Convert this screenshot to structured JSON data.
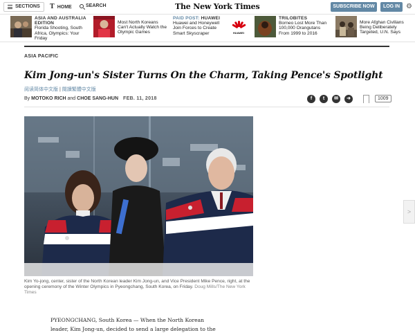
{
  "topbar": {
    "sections_label": "SECTIONS",
    "home_logo": "T",
    "home_label": "HOME",
    "search_label": "SEARCH",
    "masthead": "The New York Times",
    "subscribe_label": "SUBSCRIBE NOW",
    "login_label": "LOG IN",
    "settings_icon": "gear-icon"
  },
  "promo": [
    {
      "kicker": "ASIA AND AUSTRALIA EDITION",
      "text": "Florida Shooting, South Africa, Olympics: Your Friday"
    },
    {
      "kicker": "",
      "text": "Most North Koreans Can't Actually Watch the Olympic Games"
    },
    {
      "kicker_paid": "PAID POST:",
      "kicker": "HUAWEI",
      "text": "Huawei and Honeywell Join Forces to Create Smart Skyscraper",
      "logo_text": "HUAWEI"
    },
    {
      "kicker": "TRILOBITES",
      "text": "Borneo Lost More Than 100,000 Orangutans From 1999 to 2016"
    },
    {
      "kicker": "",
      "text": "More Afghan Civilians Being Deliberately Targeted, U.N. Says"
    }
  ],
  "article": {
    "kicker": "ASIA PACIFIC",
    "headline": "Kim Jong-un's Sister Turns On the Charm, Taking Pence's Spotlight",
    "translations_simplified": "简体中文",
    "translations_traditional": "繁體中文",
    "translations_prefix_1": "阅读简体中文版",
    "translations_sep": " | ",
    "translations_prefix_2": "閱讀繁體中文版",
    "byline_by": "By",
    "author_1": "MOTOKO RICH",
    "byline_and": "and",
    "author_2": "CHOE SANG-HUN",
    "date": "FEB. 11, 2018",
    "comment_count": "1009",
    "caption": "Kim Yo-jong, center, sister of the North Korean leader Kim Jong-un, and Vice President Mike Pence, right, at the opening ceremony of the Winter Olympics in Pyeongchang, South Korea, on Friday.",
    "credit": "Doug Mills/The New York Times",
    "body": "PYEONGCHANG, South Korea — When the North Korean leader, Kim Jong-un, decided to send a large delegation to the Winter Olympics in"
  },
  "colors": {
    "accent": "#6288a5",
    "usa_red": "#c8202f",
    "usa_navy": "#1d2a4a"
  }
}
